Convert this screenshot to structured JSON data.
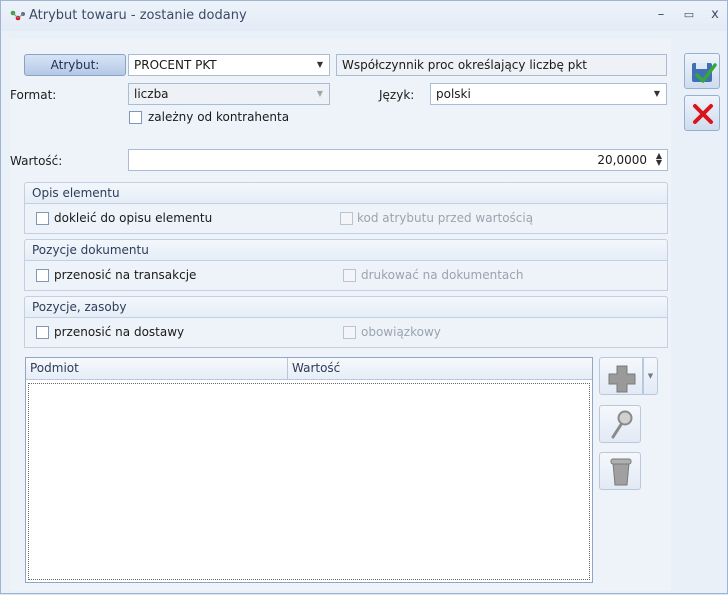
{
  "window": {
    "title": "Atrybut towaru - zostanie dodany",
    "min_glyph": "–",
    "max_glyph": "▭",
    "close_glyph": "x"
  },
  "form": {
    "attribute_button": "Atrybut:",
    "attribute_value": "PROCENT PKT",
    "attribute_description": "Współczynnik proc określający liczbę pkt",
    "format_label": "Format:",
    "format_value": "liczba",
    "language_label": "Język:",
    "language_value": "polski",
    "contractor_dependent_label": "zależny od kontrahenta",
    "value_label": "Wartość:",
    "value": "20,0000"
  },
  "groups": {
    "element_description": {
      "header": "Opis elementu",
      "option_left": "dokleić do opisu elementu",
      "option_right": "kod atrybutu przed wartością"
    },
    "document_items": {
      "header": "Pozycje dokumentu",
      "option_left": "przenosić na transakcje",
      "option_right": "drukować na dokumentach"
    },
    "items_resources": {
      "header": "Pozycje, zasoby",
      "option_left": "przenosić na dostawy",
      "option_right": "obowiązkowy"
    }
  },
  "grid": {
    "columns": [
      "Podmiot",
      "Wartość"
    ],
    "rows": []
  },
  "colors": {
    "accent": "#3f6fb5",
    "cancel_red": "#d9141b",
    "save_green": "#3aa63a"
  },
  "icons": {
    "save": "save-floppy-check-icon",
    "cancel": "red-x-icon",
    "add": "plus-icon",
    "edit": "magnifier-icon",
    "delete": "trash-bin-icon"
  }
}
